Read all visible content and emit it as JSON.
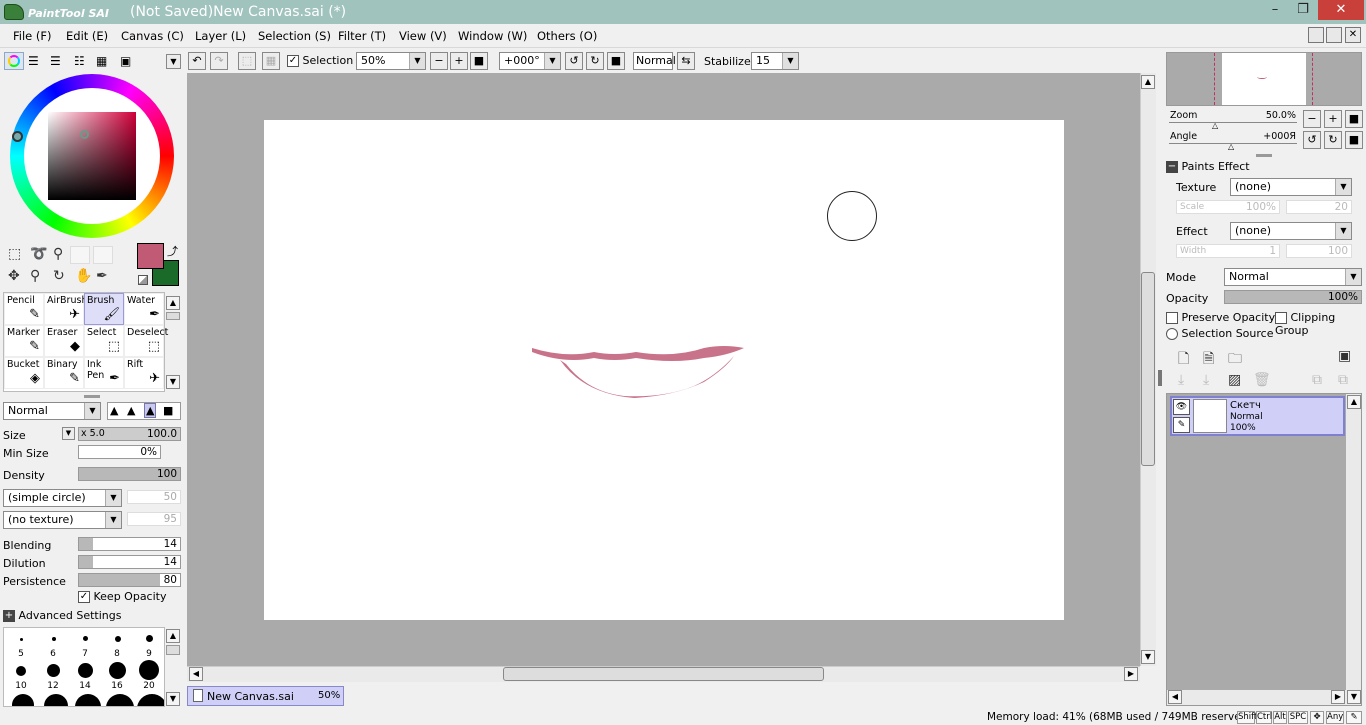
{
  "window": {
    "app_logo": "PaintTool SAI",
    "title": "(Not Saved)New Canvas.sai (*)",
    "minimize": "–",
    "restore": "❐",
    "close": "✕"
  },
  "menu": [
    "File (F)",
    "Edit (E)",
    "Canvas (C)",
    "Layer (L)",
    "Selection (S)",
    "Filter (T)",
    "View (V)",
    "Window (W)",
    "Others (O)"
  ],
  "toolbar": {
    "selection_label": "Selection",
    "zoom_value": "50%",
    "angle_value": "+000°",
    "blend_mode": "Normal",
    "stabilizer_label": "Stabilizer",
    "stabilizer_value": "15"
  },
  "color": {
    "primary": "#c05a75",
    "secondary": "#1a6b2a"
  },
  "tools": [
    {
      "name": "Pencil",
      "icon": "✎"
    },
    {
      "name": "AirBrush",
      "icon": "✈"
    },
    {
      "name": "Brush",
      "icon": "🖌"
    },
    {
      "name": "Water",
      "icon": "✒"
    },
    {
      "name": "Marker",
      "icon": "✎"
    },
    {
      "name": "Eraser",
      "icon": "◆"
    },
    {
      "name": "Select",
      "icon": "⬚"
    },
    {
      "name": "Deselect",
      "icon": "⬚"
    },
    {
      "name": "Bucket",
      "icon": "◈"
    },
    {
      "name": "Binary",
      "icon": "✎"
    },
    {
      "name": "Ink Pen",
      "icon": "✒"
    },
    {
      "name": "Rift",
      "icon": "✈"
    }
  ],
  "brush": {
    "mode": "Normal",
    "size_label": "Size",
    "size_mult": "x 5.0",
    "size_value": "100.0",
    "min_size_label": "Min Size",
    "min_size_value": "0%",
    "density_label": "Density",
    "density_value": "100",
    "shape": "(simple circle)",
    "shape_value": "50",
    "texture": "(no texture)",
    "texture_value": "95",
    "blending_label": "Blending",
    "blending_value": "14",
    "dilution_label": "Dilution",
    "dilution_value": "14",
    "persistence_label": "Persistence",
    "persistence_value": "80",
    "keep_opacity": "Keep Opacity",
    "advanced": "Advanced Settings",
    "sizes_row1": [
      "5",
      "6",
      "7",
      "8",
      "9"
    ],
    "sizes_row2": [
      "10",
      "12",
      "14",
      "16",
      "20"
    ]
  },
  "navigator": {
    "zoom_label": "Zoom",
    "zoom_value": "50.0%",
    "angle_label": "Angle",
    "angle_value": "+000Я"
  },
  "paints_effect": {
    "header": "Paints Effect",
    "texture_label": "Texture",
    "texture_value": "(none)",
    "scale_label": "Scale",
    "scale_value": "100%",
    "scale_value2": "20",
    "effect_label": "Effect",
    "effect_value": "(none)",
    "width_label": "Width",
    "width_value": "1",
    "width_value2": "100"
  },
  "layer_props": {
    "mode_label": "Mode",
    "mode_value": "Normal",
    "opacity_label": "Opacity",
    "opacity_value": "100%",
    "preserve_opacity": "Preserve Opacity",
    "clipping_group": "Clipping Group",
    "selection_source": "Selection Source"
  },
  "layers": [
    {
      "name": "Скетч",
      "mode": "Normal",
      "opacity": "100%"
    }
  ],
  "tabs": [
    {
      "name": "New Canvas.sai",
      "zoom": "50%"
    }
  ],
  "status": {
    "memory": "Memory load: 41% (68MB used / 749MB reserved)",
    "keys": [
      "Shift",
      "Ctrl",
      "Alt",
      "SPC",
      "Any"
    ]
  }
}
